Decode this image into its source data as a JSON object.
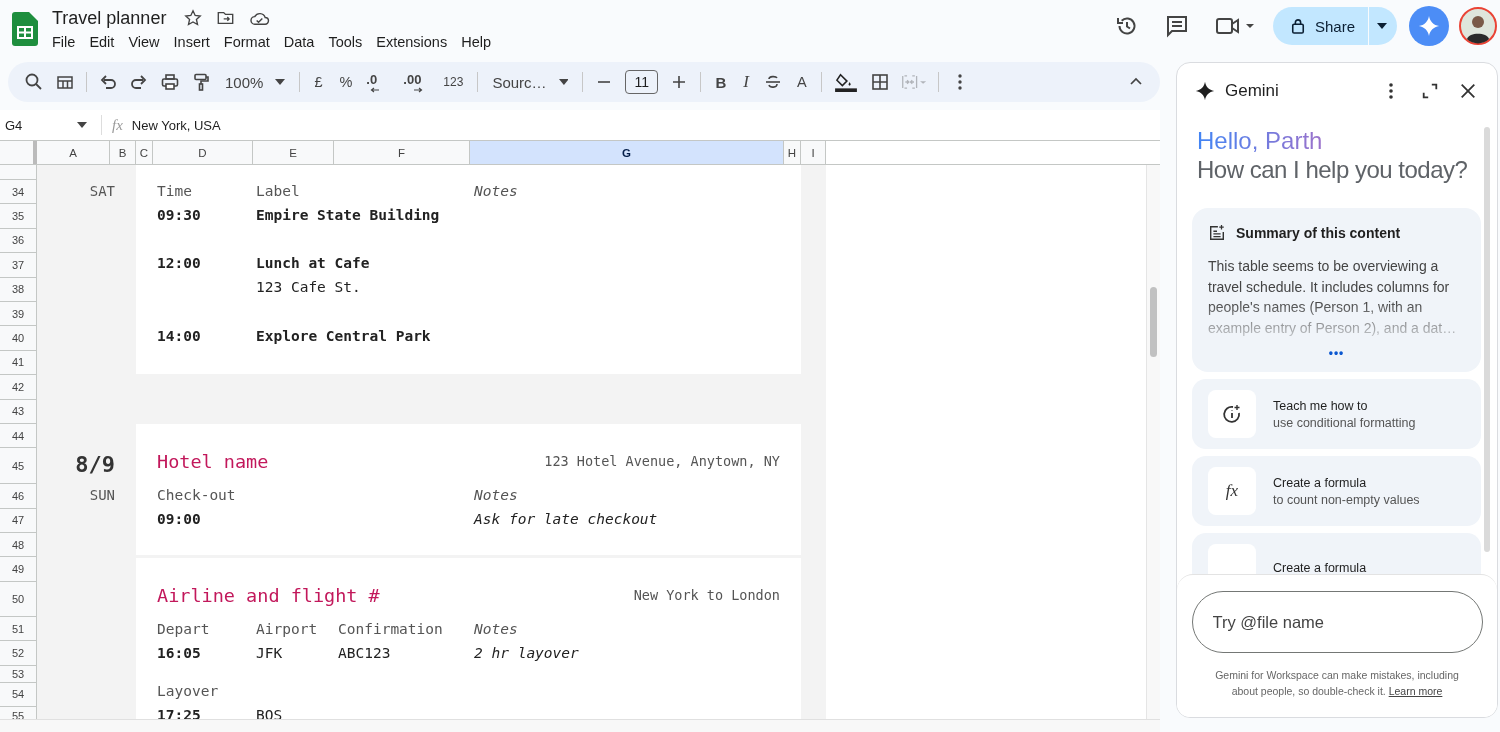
{
  "app": {
    "title": "Travel planner",
    "menu": [
      "File",
      "Edit",
      "View",
      "Insert",
      "Format",
      "Data",
      "Tools",
      "Extensions",
      "Help"
    ],
    "share": "Share"
  },
  "toolbar": {
    "zoom": "100%",
    "currency": "£",
    "percent": "%",
    "decrease_decimals": ".0",
    "increase_decimals": ".00",
    "number_format": "123",
    "font": "Sourc…",
    "font_size": "11",
    "bold": "B",
    "italic": "I",
    "text_color": "A",
    "merge_disabled": true
  },
  "formula_bar": {
    "cell": "G4",
    "fx": "fx",
    "value": "New York, USA"
  },
  "columns": [
    {
      "label": "A",
      "selected": false
    },
    {
      "label": "B",
      "selected": false
    },
    {
      "label": "C",
      "selected": false
    },
    {
      "label": "D",
      "selected": false
    },
    {
      "label": "E",
      "selected": false
    },
    {
      "label": "F",
      "selected": false
    },
    {
      "label": "G",
      "selected": true
    },
    {
      "label": "H",
      "selected": false
    },
    {
      "label": "I",
      "selected": false
    }
  ],
  "rows": [
    "34",
    "35",
    "36",
    "37",
    "38",
    "39",
    "40",
    "41",
    "42",
    "43",
    "44",
    "45",
    "46",
    "47",
    "48",
    "49",
    "50",
    "51",
    "52",
    "53",
    "54",
    "55"
  ],
  "schedule": [
    {
      "weekday": "SAT",
      "cards": [
        {
          "lines": [
            {
              "kind": "labels",
              "cells": [
                "Time",
                "Label",
                null,
                "Notes"
              ]
            },
            {
              "kind": "activity",
              "cells": [
                "09:30",
                "Empire State Building",
                null,
                null
              ]
            },
            {
              "kind": "activity",
              "cells": [
                "12:00",
                "Lunch at Cafe",
                null,
                null
              ]
            },
            {
              "kind": "detail",
              "cells": [
                null,
                "123 Cafe St.",
                null,
                null
              ]
            },
            {
              "kind": "activity",
              "cells": [
                "14:00",
                "Explore Central Park",
                null,
                null
              ]
            }
          ]
        }
      ]
    },
    {
      "date": "8/9",
      "weekday": "SUN",
      "cards": [
        {
          "title": "Hotel name",
          "location": "123 Hotel Avenue, Anytown, NY",
          "lines": [
            {
              "kind": "labels",
              "cells": [
                "Check-out",
                null,
                null,
                "Notes"
              ]
            },
            {
              "kind": "times",
              "cells": [
                "09:00",
                null,
                null,
                "Ask for late checkout"
              ]
            }
          ]
        },
        {
          "title": "Airline and flight #",
          "location": "New York to London",
          "lines": [
            {
              "kind": "labels",
              "cells": [
                "Depart",
                "Airport",
                "Confirmation",
                "Notes"
              ]
            },
            {
              "kind": "times",
              "cells": [
                "16:05",
                "JFK",
                "ABC123",
                "2 hr layover"
              ]
            },
            {
              "kind": "labels",
              "cells": [
                "Layover",
                null,
                null,
                null
              ]
            },
            {
              "kind": "times",
              "cells": [
                "17:25",
                "BOS",
                null,
                null
              ]
            }
          ]
        }
      ]
    }
  ],
  "gemini": {
    "title": "Gemini",
    "greeting": "Hello, Parth",
    "prompt": "How can I help you today?",
    "summary": {
      "title": "Summary of this content",
      "text": "This table seems to be overviewing a travel schedule. It includes columns for people's names (Person 1, with an example entry of Person 2), and a dat…",
      "more": "•••"
    },
    "suggestions": [
      {
        "kind": "learn",
        "title": "Teach me how to",
        "subtitle": "use conditional formatting"
      },
      {
        "kind": "formula",
        "icon_text": "fx",
        "title": "Create a formula",
        "subtitle": "to count non-empty values"
      },
      {
        "kind": "formula",
        "title": "Create a formula"
      }
    ],
    "input": {
      "placeholder": "Try @file name"
    },
    "disclaimer": "Gemini for Workspace can make mistakes, including about people, so double-check it.",
    "link": "Learn more"
  }
}
